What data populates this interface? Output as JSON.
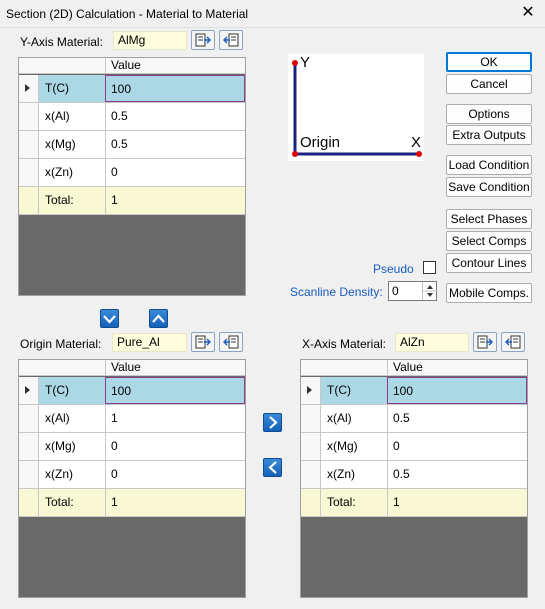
{
  "window": {
    "title": "Section (2D) Calculation - Material to Material",
    "close_glyph": "✕"
  },
  "y_axis": {
    "label": "Y-Axis Material:",
    "material": "AlMg",
    "grid": {
      "col_header": "Value",
      "rows": [
        {
          "name": "T(C)",
          "value": "100"
        },
        {
          "name": "x(Al)",
          "value": "0.5"
        },
        {
          "name": "x(Mg)",
          "value": "0.5"
        },
        {
          "name": "x(Zn)",
          "value": "0"
        },
        {
          "name": "Total:",
          "value": "1"
        }
      ]
    }
  },
  "origin": {
    "label": "Origin Material:",
    "material": "Pure_Al",
    "grid": {
      "col_header": "Value",
      "rows": [
        {
          "name": "T(C)",
          "value": "100"
        },
        {
          "name": "x(Al)",
          "value": "1"
        },
        {
          "name": "x(Mg)",
          "value": "0"
        },
        {
          "name": "x(Zn)",
          "value": "0"
        },
        {
          "name": "Total:",
          "value": "1"
        }
      ]
    }
  },
  "x_axis": {
    "label": "X-Axis Material:",
    "material": "AlZn",
    "grid": {
      "col_header": "Value",
      "rows": [
        {
          "name": "T(C)",
          "value": "100"
        },
        {
          "name": "x(Al)",
          "value": "0.5"
        },
        {
          "name": "x(Mg)",
          "value": "0"
        },
        {
          "name": "x(Zn)",
          "value": "0.5"
        },
        {
          "name": "Total:",
          "value": "1"
        }
      ]
    }
  },
  "diagram": {
    "y_label": "Y",
    "x_label": "X",
    "origin_label": "Origin",
    "axis_color": "#1a237e",
    "point_color": "#e00000"
  },
  "buttons": {
    "ok": "OK",
    "cancel": "Cancel",
    "options": "Options",
    "extra_outputs": "Extra Outputs",
    "load_condition": "Load Condition",
    "save_condition": "Save Condition",
    "select_phases": "Select Phases",
    "select_comps": "Select Comps",
    "contour_lines": "Contour Lines",
    "mobile_comps": "Mobile Comps."
  },
  "pseudo": {
    "label": "Pseudo",
    "checked": false
  },
  "scanline": {
    "label": "Scanline Density:",
    "value": "0"
  }
}
